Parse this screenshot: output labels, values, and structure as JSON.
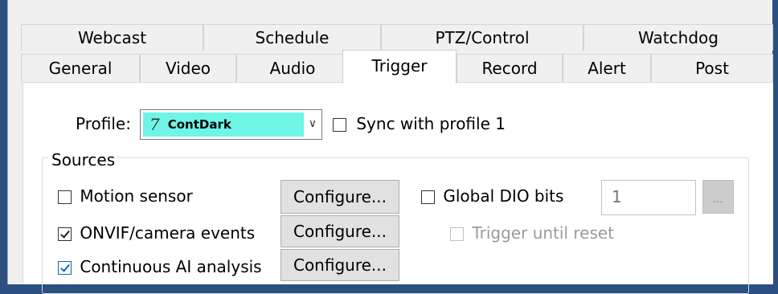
{
  "tabs": {
    "row1": [
      {
        "label": "Webcast"
      },
      {
        "label": "Schedule"
      },
      {
        "label": "PTZ/Control"
      },
      {
        "label": "Watchdog"
      }
    ],
    "row2": [
      {
        "label": "General"
      },
      {
        "label": "Video"
      },
      {
        "label": "Audio"
      },
      {
        "label": "Trigger",
        "active": true
      },
      {
        "label": "Record"
      },
      {
        "label": "Alert"
      },
      {
        "label": "Post"
      }
    ]
  },
  "profile": {
    "label": "Profile:",
    "icon_glyph": "7",
    "value": "ContDark",
    "highlight_color": "#6ff5e6",
    "sync_label": "Sync with profile 1",
    "sync_checked": false
  },
  "sources": {
    "title": "Sources",
    "motion_label": "Motion sensor",
    "motion_checked": false,
    "onvif_label": "ONVIF/camera events",
    "onvif_checked": true,
    "continuous_label": "Continuous AI analysis",
    "continuous_checked": true,
    "configure_label": "Configure...",
    "global_dio_label": "Global DIO bits",
    "global_dio_checked": false,
    "dio_value": "1",
    "dots_label": "...",
    "trigger_until_reset_label": "Trigger until reset",
    "trigger_until_reset_checked": false
  },
  "colors": {
    "accent": "#0a64c8",
    "desktop": "#2b4f80"
  }
}
